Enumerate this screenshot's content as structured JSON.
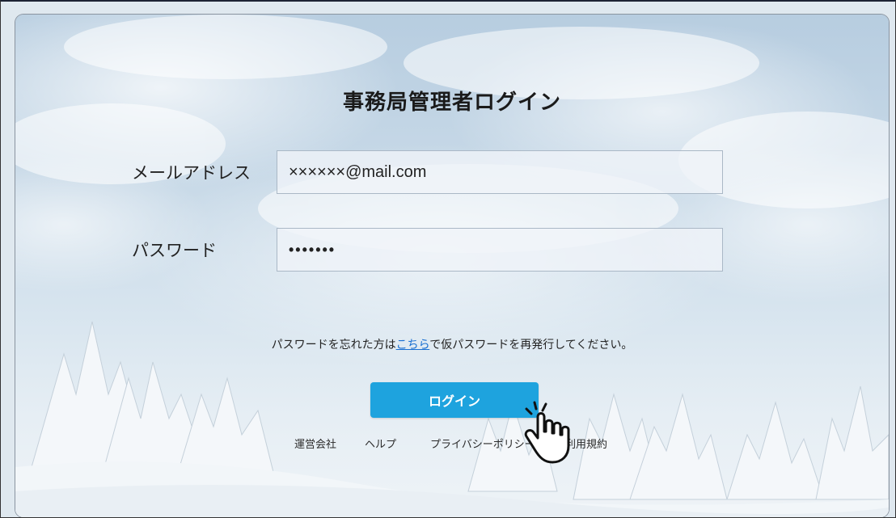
{
  "page": {
    "title": "事務局管理者ログイン"
  },
  "form": {
    "email_label": "メールアドレス",
    "email_value": "××××××@mail.com",
    "password_label": "パスワード",
    "password_masked": "•••••••"
  },
  "forgot": {
    "prefix": "パスワードを忘れた方は",
    "link": "こちら",
    "suffix": "で仮パスワードを再発行してください。"
  },
  "login_button": {
    "label": "ログイン"
  },
  "footer": {
    "links": [
      "運営会社",
      "ヘルプ",
      "プライバシーポリシー",
      "利用規約"
    ]
  },
  "colors": {
    "button": "#1ea3de",
    "link": "#1a6fd1",
    "sky": "#c9dae8"
  },
  "icons": {
    "cursor": "hand-pointer-icon"
  }
}
